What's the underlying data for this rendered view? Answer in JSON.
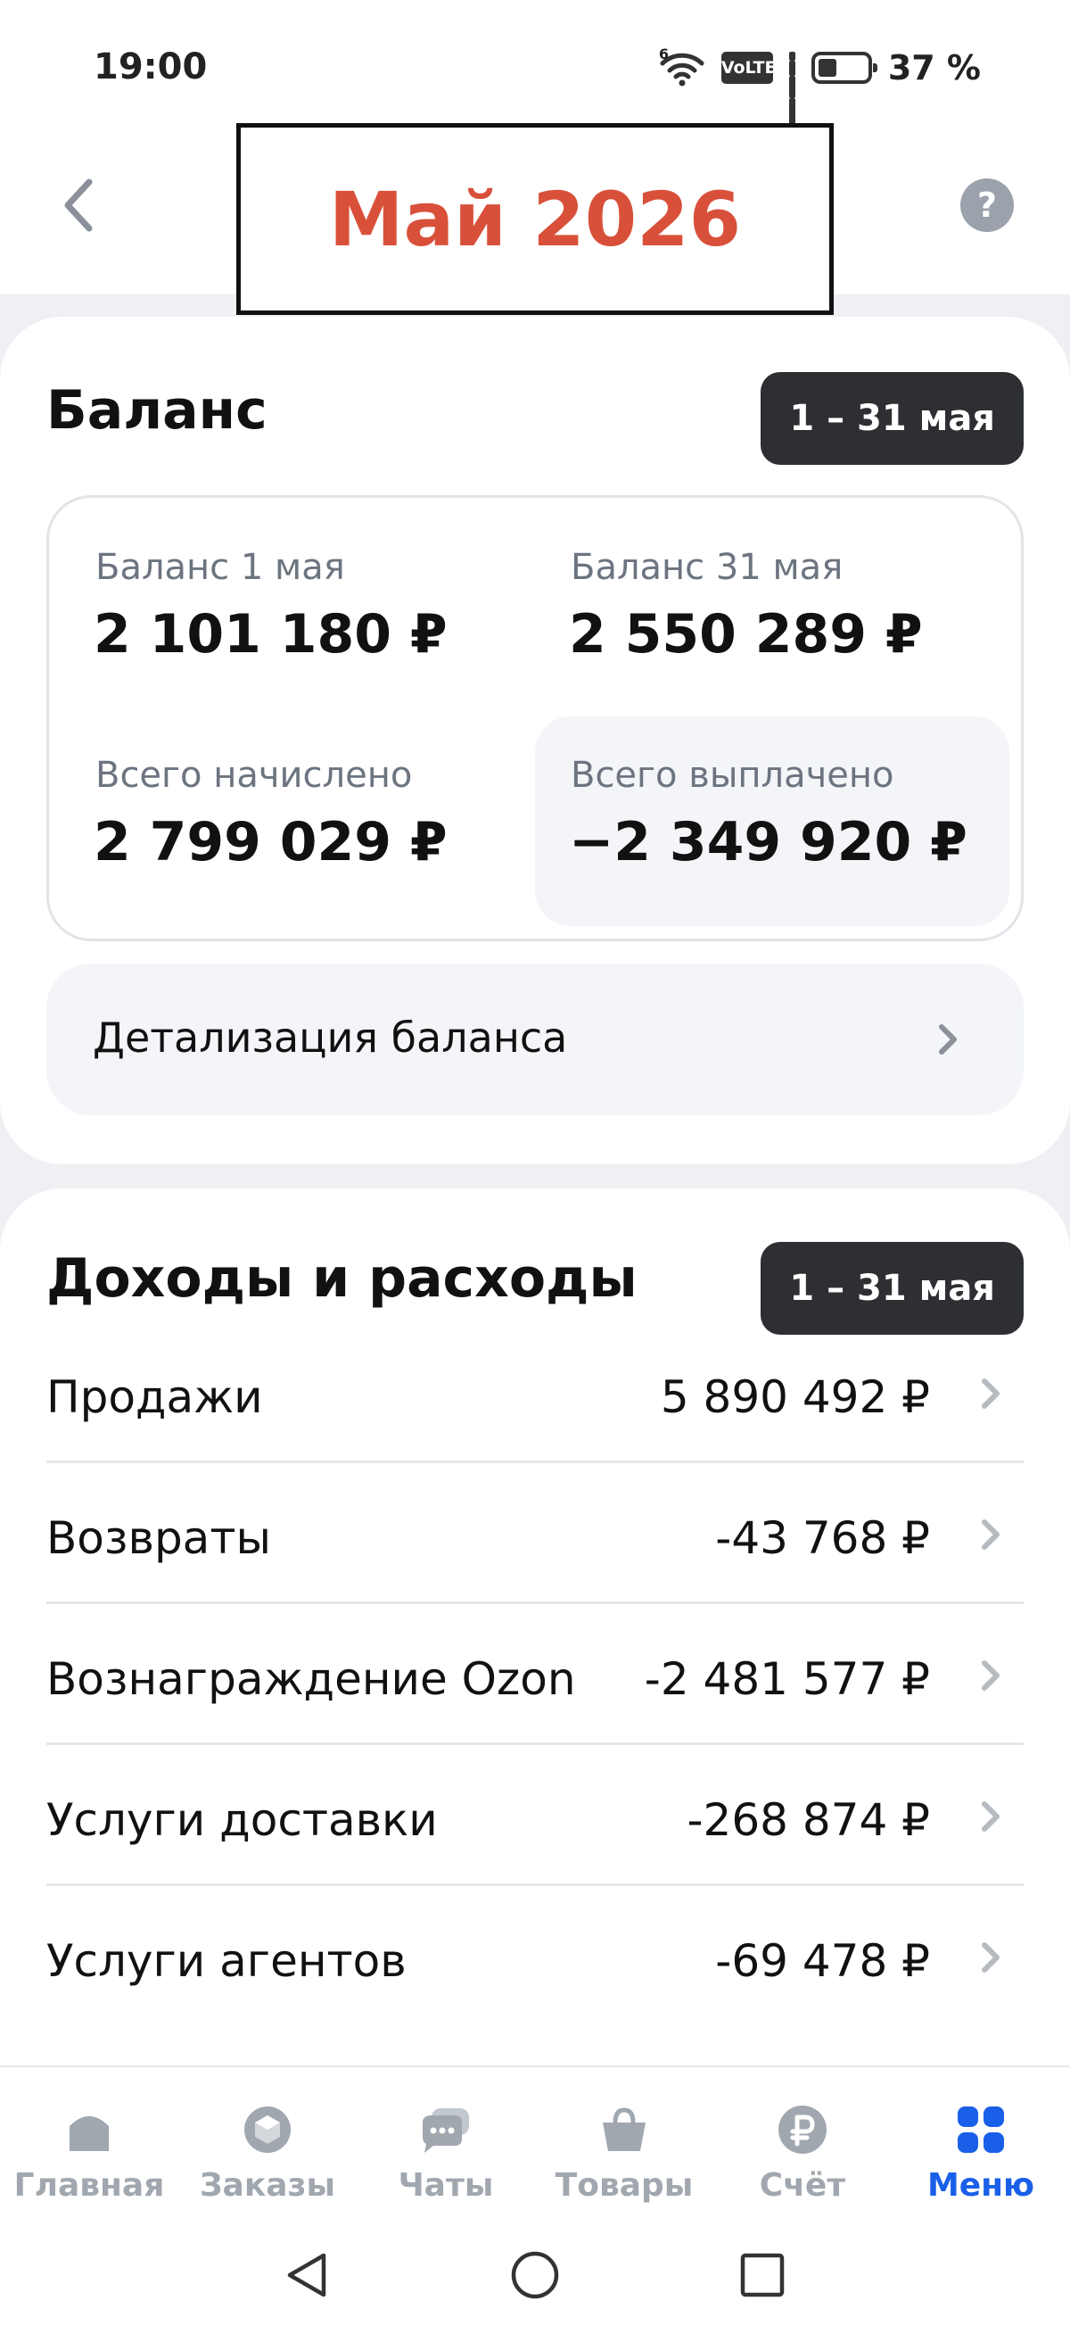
{
  "status_bar": {
    "time": "19:00",
    "network_gen": "6",
    "volte": "VoLTE",
    "battery_percent": "37 %",
    "battery_level": 0.37
  },
  "header": {
    "title": "Май 2026",
    "title_color": "#d9503a",
    "back_icon": "chevron-left-icon",
    "help_icon": "question-icon",
    "help_glyph": "?"
  },
  "balance": {
    "title": "Баланс",
    "period": "1 – 31 мая",
    "cells": [
      {
        "label": "Баланс 1 мая",
        "value": "2 101 180 ₽"
      },
      {
        "label": "Баланс 31 мая",
        "value": "2 550 289 ₽"
      },
      {
        "label": "Всего начислено",
        "value": "2 799 029 ₽"
      },
      {
        "label": "Всего выплачено",
        "value": "−2 349 920 ₽"
      }
    ],
    "detail_link": "Детализация баланса"
  },
  "income": {
    "title": "Доходы и расходы",
    "period": "1 – 31 мая",
    "rows": [
      {
        "label": "Продажи",
        "amount": "5 890 492 ₽"
      },
      {
        "label": "Возвраты",
        "amount": "-43 768 ₽"
      },
      {
        "label": "Вознаграждение Ozon",
        "amount": "-2 481 577 ₽"
      },
      {
        "label": "Услуги доставки",
        "amount": "-268 874 ₽"
      },
      {
        "label": "Услуги агентов",
        "amount": "-69 478 ₽"
      }
    ]
  },
  "bottom_nav": {
    "items": [
      {
        "label": "Главная",
        "icon": "home-icon"
      },
      {
        "label": "Заказы",
        "icon": "box-icon"
      },
      {
        "label": "Чаты",
        "icon": "chat-icon"
      },
      {
        "label": "Товары",
        "icon": "bag-icon"
      },
      {
        "label": "Счёт",
        "icon": "ruble-icon"
      },
      {
        "label": "Меню",
        "icon": "grid-icon",
        "active": true
      }
    ],
    "active_color": "#1a5fe8",
    "inactive_color": "#a1a7af"
  },
  "system_nav": {
    "back_icon": "triangle-back-icon",
    "home_icon": "circle-home-icon",
    "recents_icon": "square-recents-icon"
  }
}
